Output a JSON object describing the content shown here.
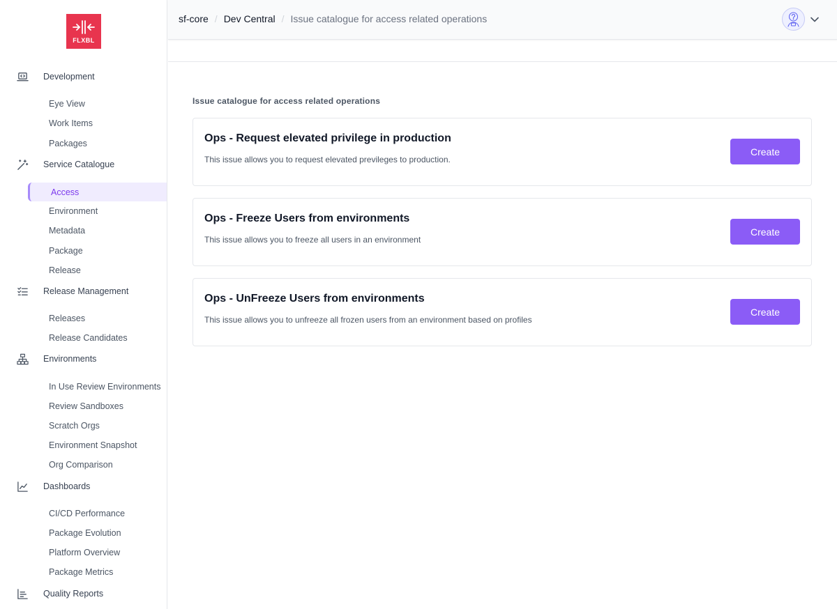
{
  "logo": {
    "text": "FLXBL"
  },
  "breadcrumb": [
    "sf-core",
    "Dev Central",
    "Issue catalogue for access related operations"
  ],
  "sidebar": {
    "sections": [
      {
        "label": "Development",
        "icon": "code-laptop-icon",
        "items": [
          {
            "label": "Eye View"
          },
          {
            "label": "Work Items"
          },
          {
            "label": "Packages"
          }
        ]
      },
      {
        "label": "Service Catalogue",
        "icon": "magic-wand-icon",
        "items": [
          {
            "label": "Access",
            "active": true
          },
          {
            "label": "Environment"
          },
          {
            "label": "Metadata"
          },
          {
            "label": "Package"
          },
          {
            "label": "Release"
          }
        ]
      },
      {
        "label": "Release Management",
        "icon": "checklist-icon",
        "items": [
          {
            "label": "Releases"
          },
          {
            "label": "Release Candidates"
          }
        ]
      },
      {
        "label": "Environments",
        "icon": "network-icon",
        "items": [
          {
            "label": "In Use Review Environments"
          },
          {
            "label": "Review Sandboxes"
          },
          {
            "label": "Scratch Orgs"
          },
          {
            "label": "Environment Snapshot"
          },
          {
            "label": "Org Comparison"
          }
        ]
      },
      {
        "label": "Dashboards",
        "icon": "line-chart-icon",
        "items": [
          {
            "label": "CI/CD Performance"
          },
          {
            "label": "Package Evolution"
          },
          {
            "label": "Platform Overview"
          },
          {
            "label": "Package Metrics"
          }
        ]
      },
      {
        "label": "Quality Reports",
        "icon": "bar-chart-icon",
        "items": []
      }
    ]
  },
  "main": {
    "section_title": "Issue catalogue for access related operations",
    "cards": [
      {
        "title": "Ops - Request elevated privilege in production",
        "description": "This issue allows you to request elevated previleges to production.",
        "button": "Create"
      },
      {
        "title": "Ops - Freeze Users from environments",
        "description": "This issue allows you to freeze all users in an environment",
        "button": "Create"
      },
      {
        "title": "Ops - UnFreeze Users from environments",
        "description": "This issue allows you to unfreeze all frozen users from an environment based on profiles",
        "button": "Create"
      }
    ]
  },
  "colors": {
    "brand": "#e8344e",
    "accent": "#8b5cf6",
    "active_bg": "#f0ecfe",
    "active_text": "#7c3aed"
  }
}
